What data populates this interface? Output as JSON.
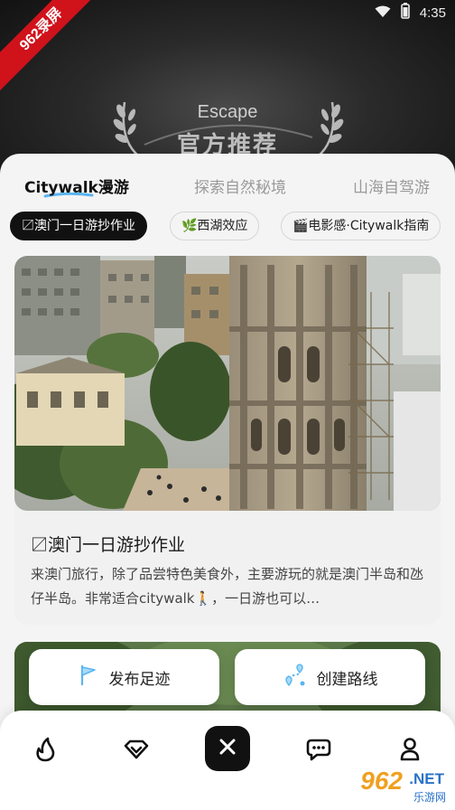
{
  "status_bar": {
    "time": "4:35"
  },
  "watermark_ribbon": {
    "text": "962录屏"
  },
  "hero": {
    "subtitle": "Escape",
    "title": "官方推荐"
  },
  "tabs": [
    {
      "label": "Citywalk漫游",
      "active": true
    },
    {
      "label": "探索自然秘境",
      "active": false
    },
    {
      "label": "山海自驾游",
      "active": false
    }
  ],
  "chips": [
    {
      "label": "〼澳门一日游抄作业",
      "active": true
    },
    {
      "label": "🌿西湖效应",
      "active": false
    },
    {
      "label": "🎬电影感·Citywalk指南",
      "active": false
    }
  ],
  "card": {
    "title": "〼澳门一日游抄作业",
    "description": "来澳门旅行，除了品尝特色美食外，主要游玩的就是澳门半岛和氹仔半岛。非常适合citywalk🚶，一日游也可以…"
  },
  "actions": {
    "publish_label": "发布足迹",
    "create_route_label": "创建路线"
  },
  "bottom_nav": [
    {
      "icon": "flame-icon"
    },
    {
      "icon": "diamond-icon"
    },
    {
      "icon": "close-icon"
    },
    {
      "icon": "chat-icon"
    },
    {
      "icon": "profile-icon"
    }
  ],
  "site_watermark": {
    "brand": "962",
    "suffix": ".NET",
    "sub": "乐游网"
  },
  "colors": {
    "accent_blue": "#5ab4f0",
    "chip_active_bg": "#111111",
    "sheet_bg": "#f4f4f4"
  }
}
